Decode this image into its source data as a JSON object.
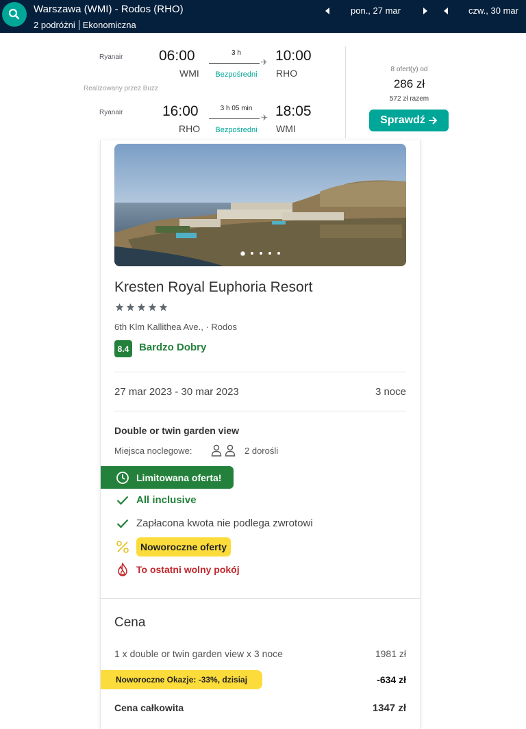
{
  "header": {
    "route": "Warszawa (WMI) - Rodos (RHO)",
    "travellers": "2 podróżni",
    "cabin": "Ekonomiczna",
    "depart_date": "pon., 27 mar",
    "return_date": "czw., 30 mar"
  },
  "flights": {
    "outbound": {
      "airline": "Ryanair",
      "dep_time": "06:00",
      "dep_code": "WMI",
      "duration": "3 h",
      "stops": "Bezpośredni",
      "arr_time": "10:00",
      "arr_code": "RHO"
    },
    "operated_by": "Realizowany przez Buzz",
    "inbound": {
      "airline": "Ryanair",
      "dep_time": "16:00",
      "dep_code": "RHO",
      "duration": "3 h 05 min",
      "stops": "Bezpośredni",
      "arr_time": "18:05",
      "arr_code": "WMI"
    },
    "offers": "8 ofert(y) od",
    "price": "286 zł",
    "total": "572 zł razem",
    "check_label": "Sprawdź"
  },
  "hotel": {
    "name": "Kresten Royal Euphoria Resort",
    "stars": 5,
    "address": "6th Klm Kallithea Ave., · Rodos",
    "score": "8.4",
    "score_label": "Bardzo Dobry",
    "photo_count": 5,
    "photo_active": 1,
    "dates": "27 mar 2023 - 30 mar 2023",
    "nights": "3 noce",
    "room": "Double or twin garden view",
    "beds_label": "Miejsca noclegowe:",
    "beds_value": "2 dorośli",
    "limited": "Limitowana oferta!",
    "board": "All inclusive",
    "refund": "Zapłacona kwota nie podlega zwrotowi",
    "new_year": "Noworoczne oferty",
    "last_room": "To ostatni wolny pokój"
  },
  "price": {
    "title": "Cena",
    "line_desc": "1 x double or twin garden view x 3 noce",
    "line_value": "1981 zł",
    "promo": "Noworoczne Okazje: -33%, dzisiaj",
    "promo_value": "-634 zł",
    "total_label": "Cena całkowita",
    "total_value": "1347 zł"
  },
  "colors": {
    "header_bg": "#05203c",
    "accent": "#00a698",
    "green": "#23813b",
    "yellow": "#fcdc3b",
    "red": "#c0272d"
  }
}
